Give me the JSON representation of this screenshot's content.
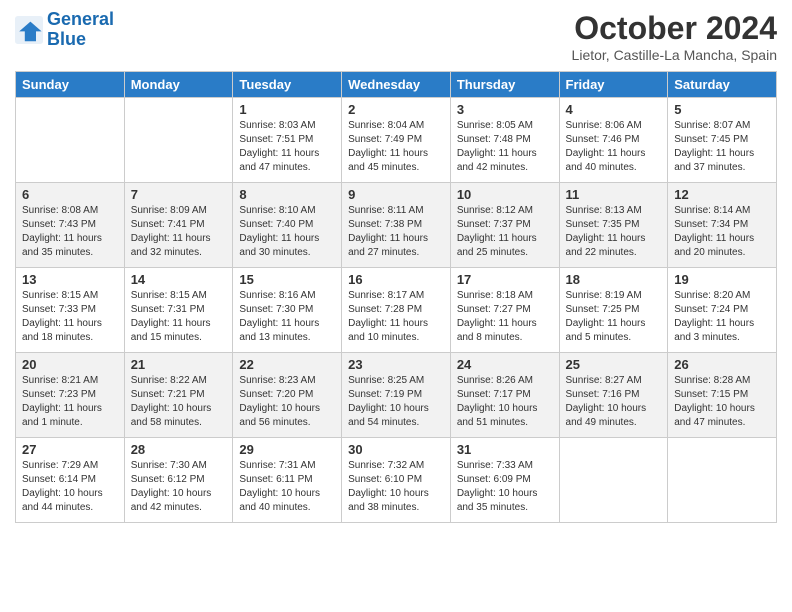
{
  "header": {
    "logo_line1": "General",
    "logo_line2": "Blue",
    "month_title": "October 2024",
    "location": "Lietor, Castille-La Mancha, Spain"
  },
  "days_of_week": [
    "Sunday",
    "Monday",
    "Tuesday",
    "Wednesday",
    "Thursday",
    "Friday",
    "Saturday"
  ],
  "weeks": [
    [
      {
        "day": "",
        "info": ""
      },
      {
        "day": "",
        "info": ""
      },
      {
        "day": "1",
        "info": "Sunrise: 8:03 AM\nSunset: 7:51 PM\nDaylight: 11 hours and 47 minutes."
      },
      {
        "day": "2",
        "info": "Sunrise: 8:04 AM\nSunset: 7:49 PM\nDaylight: 11 hours and 45 minutes."
      },
      {
        "day": "3",
        "info": "Sunrise: 8:05 AM\nSunset: 7:48 PM\nDaylight: 11 hours and 42 minutes."
      },
      {
        "day": "4",
        "info": "Sunrise: 8:06 AM\nSunset: 7:46 PM\nDaylight: 11 hours and 40 minutes."
      },
      {
        "day": "5",
        "info": "Sunrise: 8:07 AM\nSunset: 7:45 PM\nDaylight: 11 hours and 37 minutes."
      }
    ],
    [
      {
        "day": "6",
        "info": "Sunrise: 8:08 AM\nSunset: 7:43 PM\nDaylight: 11 hours and 35 minutes."
      },
      {
        "day": "7",
        "info": "Sunrise: 8:09 AM\nSunset: 7:41 PM\nDaylight: 11 hours and 32 minutes."
      },
      {
        "day": "8",
        "info": "Sunrise: 8:10 AM\nSunset: 7:40 PM\nDaylight: 11 hours and 30 minutes."
      },
      {
        "day": "9",
        "info": "Sunrise: 8:11 AM\nSunset: 7:38 PM\nDaylight: 11 hours and 27 minutes."
      },
      {
        "day": "10",
        "info": "Sunrise: 8:12 AM\nSunset: 7:37 PM\nDaylight: 11 hours and 25 minutes."
      },
      {
        "day": "11",
        "info": "Sunrise: 8:13 AM\nSunset: 7:35 PM\nDaylight: 11 hours and 22 minutes."
      },
      {
        "day": "12",
        "info": "Sunrise: 8:14 AM\nSunset: 7:34 PM\nDaylight: 11 hours and 20 minutes."
      }
    ],
    [
      {
        "day": "13",
        "info": "Sunrise: 8:15 AM\nSunset: 7:33 PM\nDaylight: 11 hours and 18 minutes."
      },
      {
        "day": "14",
        "info": "Sunrise: 8:15 AM\nSunset: 7:31 PM\nDaylight: 11 hours and 15 minutes."
      },
      {
        "day": "15",
        "info": "Sunrise: 8:16 AM\nSunset: 7:30 PM\nDaylight: 11 hours and 13 minutes."
      },
      {
        "day": "16",
        "info": "Sunrise: 8:17 AM\nSunset: 7:28 PM\nDaylight: 11 hours and 10 minutes."
      },
      {
        "day": "17",
        "info": "Sunrise: 8:18 AM\nSunset: 7:27 PM\nDaylight: 11 hours and 8 minutes."
      },
      {
        "day": "18",
        "info": "Sunrise: 8:19 AM\nSunset: 7:25 PM\nDaylight: 11 hours and 5 minutes."
      },
      {
        "day": "19",
        "info": "Sunrise: 8:20 AM\nSunset: 7:24 PM\nDaylight: 11 hours and 3 minutes."
      }
    ],
    [
      {
        "day": "20",
        "info": "Sunrise: 8:21 AM\nSunset: 7:23 PM\nDaylight: 11 hours and 1 minute."
      },
      {
        "day": "21",
        "info": "Sunrise: 8:22 AM\nSunset: 7:21 PM\nDaylight: 10 hours and 58 minutes."
      },
      {
        "day": "22",
        "info": "Sunrise: 8:23 AM\nSunset: 7:20 PM\nDaylight: 10 hours and 56 minutes."
      },
      {
        "day": "23",
        "info": "Sunrise: 8:25 AM\nSunset: 7:19 PM\nDaylight: 10 hours and 54 minutes."
      },
      {
        "day": "24",
        "info": "Sunrise: 8:26 AM\nSunset: 7:17 PM\nDaylight: 10 hours and 51 minutes."
      },
      {
        "day": "25",
        "info": "Sunrise: 8:27 AM\nSunset: 7:16 PM\nDaylight: 10 hours and 49 minutes."
      },
      {
        "day": "26",
        "info": "Sunrise: 8:28 AM\nSunset: 7:15 PM\nDaylight: 10 hours and 47 minutes."
      }
    ],
    [
      {
        "day": "27",
        "info": "Sunrise: 7:29 AM\nSunset: 6:14 PM\nDaylight: 10 hours and 44 minutes."
      },
      {
        "day": "28",
        "info": "Sunrise: 7:30 AM\nSunset: 6:12 PM\nDaylight: 10 hours and 42 minutes."
      },
      {
        "day": "29",
        "info": "Sunrise: 7:31 AM\nSunset: 6:11 PM\nDaylight: 10 hours and 40 minutes."
      },
      {
        "day": "30",
        "info": "Sunrise: 7:32 AM\nSunset: 6:10 PM\nDaylight: 10 hours and 38 minutes."
      },
      {
        "day": "31",
        "info": "Sunrise: 7:33 AM\nSunset: 6:09 PM\nDaylight: 10 hours and 35 minutes."
      },
      {
        "day": "",
        "info": ""
      },
      {
        "day": "",
        "info": ""
      }
    ]
  ]
}
